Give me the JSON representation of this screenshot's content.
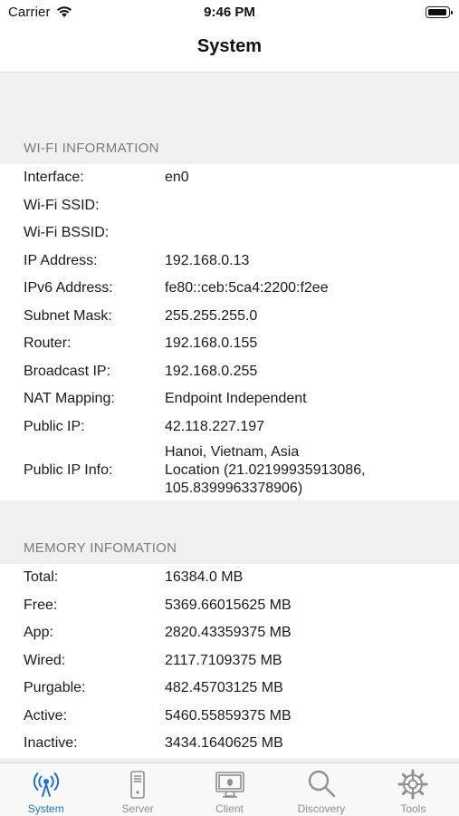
{
  "status_bar": {
    "carrier": "Carrier",
    "time": "9:46 PM"
  },
  "nav": {
    "title": "System"
  },
  "wifi_section": {
    "header": "WI-FI INFORMATION",
    "rows": [
      {
        "label": "Interface:",
        "value": "en0"
      },
      {
        "label": "Wi-Fi SSID:",
        "value": ""
      },
      {
        "label": "Wi-Fi BSSID:",
        "value": ""
      },
      {
        "label": "IP Address:",
        "value": "192.168.0.13"
      },
      {
        "label": "IPv6 Address:",
        "value": "fe80::ceb:5ca4:2200:f2ee"
      },
      {
        "label": "Subnet Mask:",
        "value": "255.255.255.0"
      },
      {
        "label": "Router:",
        "value": "192.168.0.155"
      },
      {
        "label": "Broadcast IP:",
        "value": "192.168.0.255"
      },
      {
        "label": "NAT Mapping:",
        "value": "Endpoint Independent"
      },
      {
        "label": "Public IP:",
        "value": "42.118.227.197"
      },
      {
        "label": "Public IP Info:",
        "value_lines": [
          "Hanoi, Vietnam, Asia",
          "Location (21.02199935913086,",
          "105.8399963378906)"
        ]
      }
    ]
  },
  "memory_section": {
    "header": "MEMORY INFOMATION",
    "rows": [
      {
        "label": "Total:",
        "value": "16384.0 MB"
      },
      {
        "label": "Free:",
        "value": "5369.66015625 MB"
      },
      {
        "label": "App:",
        "value": "2820.43359375 MB"
      },
      {
        "label": "Wired:",
        "value": "2117.7109375 MB"
      },
      {
        "label": "Purgable:",
        "value": "482.45703125 MB"
      },
      {
        "label": "Active:",
        "value": "5460.55859375 MB"
      },
      {
        "label": "Inactive:",
        "value": "3434.1640625 MB"
      }
    ]
  },
  "tab_bar": {
    "tabs": [
      {
        "label": "System",
        "icon": "antenna-icon"
      },
      {
        "label": "Server",
        "icon": "server-tower-icon"
      },
      {
        "label": "Client",
        "icon": "desktop-icon"
      },
      {
        "label": "Discovery",
        "icon": "magnifier-icon"
      },
      {
        "label": "Tools",
        "icon": "gear-icon"
      }
    ],
    "active": "System"
  },
  "colors": {
    "accent": "#1a73d9",
    "inactive_tab": "#8e8e93",
    "section_bg": "#efeff4"
  }
}
